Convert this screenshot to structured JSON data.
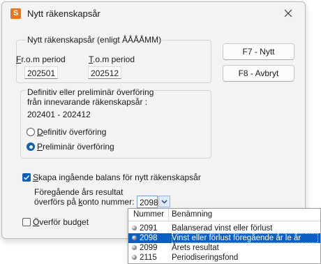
{
  "window": {
    "title": "Nytt räkenskapsår",
    "icon": "app-icon",
    "close_icon": "close-icon"
  },
  "fiscal_group": {
    "title": "Nytt räkenskapsår (enligt ÅÅÅÅMM)",
    "from_label_prefix": "F",
    "from_label_rest": "r.o.m period",
    "from_value": "202501",
    "to_label_prefix": "T",
    "to_label_rest": ".o.m period",
    "to_value": "202512"
  },
  "buttons": {
    "new_label": "F7 - Nytt",
    "cancel_label": "F8 - Avbryt"
  },
  "transfer_group": {
    "line1": "Definitiv eller preliminär överföring",
    "line2": "från innevarande räkenskapsår :",
    "period": "202401 - 202412",
    "definitive_prefix": "D",
    "definitive_rest": "efinitiv överföring",
    "definitive_selected": false,
    "preliminary_prefix": "P",
    "preliminary_rest": "reliminär överföring",
    "preliminary_selected": true
  },
  "opening_balance": {
    "checked": true,
    "label_prefix": "S",
    "label_rest": "kapa ingående balans för nytt räkenskapsår",
    "result_line1": "Föregående års resultat",
    "result_line2_pre": "överförs på ",
    "result_line2_u": "k",
    "result_line2_post": "onto nummer:",
    "account_value": "2098"
  },
  "budget": {
    "checked": false,
    "label_prefix": "Ö",
    "label_rest": "verför budget"
  },
  "account_dropdown": {
    "columns": [
      "Nummer",
      "Benämning"
    ],
    "rows": [
      {
        "number": "2091",
        "name": "Balanserad vinst eller förlust",
        "selected": false
      },
      {
        "number": "2098",
        "name": "Vinst eller förlust föregående år le år",
        "selected": true
      },
      {
        "number": "2099",
        "name": "Årets resultat",
        "selected": false
      },
      {
        "number": "2115",
        "name": "Periodiseringsfond",
        "selected": false
      }
    ]
  },
  "colors": {
    "accent": "#0a5fc4",
    "app_icon": "#e8761e",
    "dialog_bg": "#f3f3f3"
  }
}
